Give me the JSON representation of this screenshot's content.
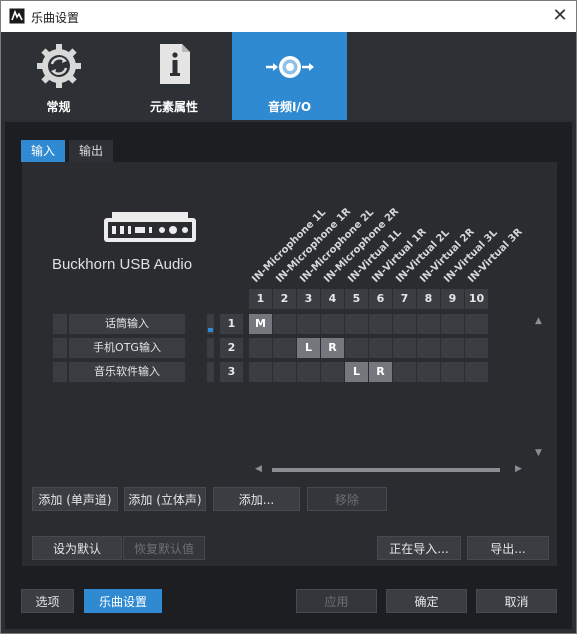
{
  "window": {
    "title": "乐曲设置"
  },
  "categories": [
    {
      "label": "常规",
      "icon": "gear-refresh-icon",
      "active": false
    },
    {
      "label": "元素属性",
      "icon": "document-info-icon",
      "active": false
    },
    {
      "label": "音频I/O",
      "icon": "audio-io-icon",
      "active": true
    }
  ],
  "tabs": [
    {
      "label": "输入",
      "active": true
    },
    {
      "label": "输出",
      "active": false
    }
  ],
  "device": {
    "name": "Buckhorn USB Audio"
  },
  "channels": {
    "labels": [
      "IN-Microphone 1L",
      "IN-Microphone 1R",
      "IN-Microphone 2L",
      "IN-Microphone 2R",
      "IN-Virtual 1L",
      "IN-Virtual 1R",
      "IN-Virtual 2L",
      "IN-Virtual 2R",
      "IN-Virtual 3L",
      "IN-Virtual 3R"
    ],
    "numbers": [
      "1",
      "2",
      "3",
      "4",
      "5",
      "6",
      "7",
      "8",
      "9",
      "10"
    ]
  },
  "inputs": [
    {
      "name": "话筒输入",
      "number": "1",
      "assignments": [
        "M",
        "",
        "",
        "",
        "",
        "",
        "",
        "",
        "",
        ""
      ]
    },
    {
      "name": "手机OTG输入",
      "number": "2",
      "assignments": [
        "",
        "",
        "L",
        "R",
        "",
        "",
        "",
        "",
        "",
        ""
      ]
    },
    {
      "name": "音乐软件输入",
      "number": "3",
      "assignments": [
        "",
        "",
        "",
        "",
        "L",
        "R",
        "",
        "",
        "",
        ""
      ]
    }
  ],
  "actions": {
    "add_mono": "添加 (单声道)",
    "add_stereo": "添加 (立体声)",
    "add_more": "添加...",
    "remove": "移除",
    "set_default": "设为默认",
    "restore_default": "恢复默认值",
    "importing": "正在导入...",
    "export": "导出..."
  },
  "footer": {
    "options": "选项",
    "song_setup": "乐曲设置",
    "apply": "应用",
    "ok": "确定",
    "cancel": "取消"
  },
  "colors": {
    "accent": "#2f8ad1",
    "panel": "#2a2c30",
    "background": "#1c1e21"
  }
}
